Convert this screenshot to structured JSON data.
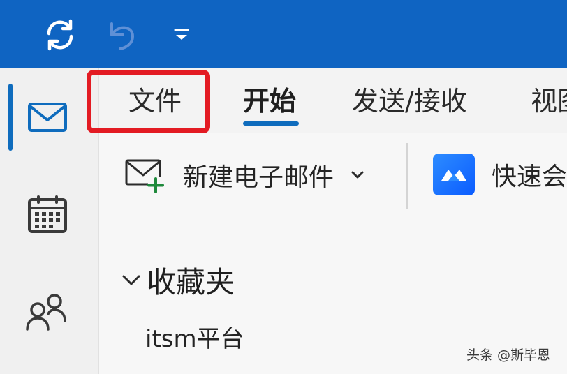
{
  "colors": {
    "titlebar": "#0f64c2",
    "accent": "#0f6cbd",
    "highlight": "#e31b23"
  },
  "titlebar": {
    "icons": [
      "sync-icon",
      "undo-icon",
      "quick-access-dropdown-icon"
    ]
  },
  "nav_rail": {
    "items": [
      {
        "name": "mail",
        "icon": "mail-icon",
        "active": true
      },
      {
        "name": "calendar",
        "icon": "calendar-icon",
        "active": false
      },
      {
        "name": "people",
        "icon": "people-icon",
        "active": false
      }
    ]
  },
  "ribbon": {
    "tabs": [
      {
        "label": "文件",
        "highlighted": true
      },
      {
        "label": "开始",
        "active": true
      },
      {
        "label": "发送/接收"
      },
      {
        "label": "视图"
      }
    ],
    "commands": {
      "new_mail_label": "新建电子邮件",
      "meeting_label": "快速会"
    }
  },
  "folder_pane": {
    "favorites_label": "收藏夹",
    "items": [
      "itsm平台"
    ]
  },
  "watermark": "头条 @斯毕恩"
}
